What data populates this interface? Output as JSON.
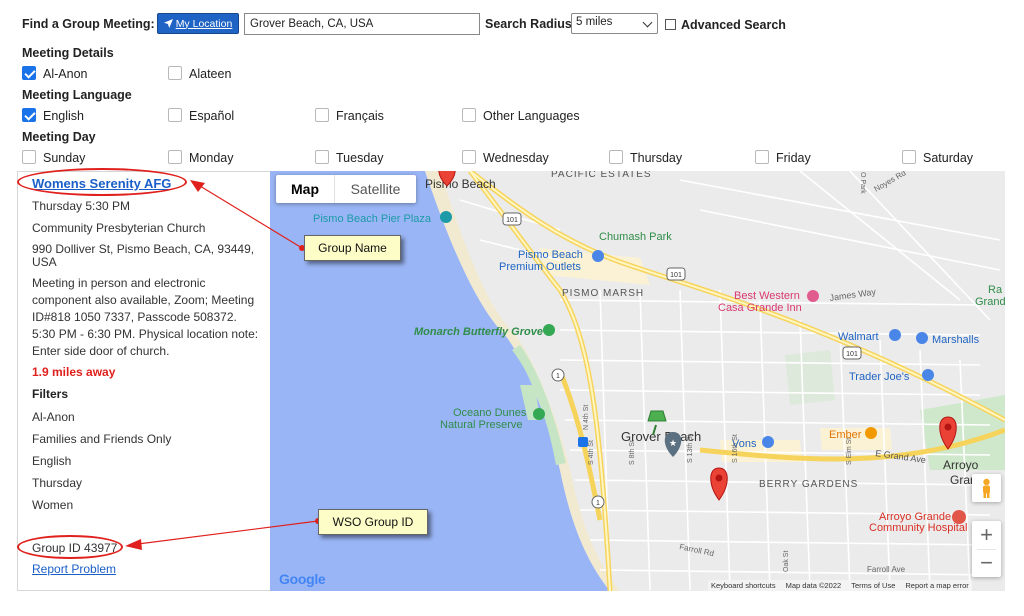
{
  "search": {
    "find_label": "Find a Group Meeting:",
    "my_location_label": "My Location",
    "location_value": "Grover Beach, CA, USA",
    "radius_label": "Search Radius",
    "radius_value": "5 miles",
    "advanced_label": "Advanced Search",
    "advanced_checked": false
  },
  "meeting_details": {
    "heading": "Meeting Details",
    "options": [
      {
        "label": "Al-Anon",
        "checked": true
      },
      {
        "label": "Alateen",
        "checked": false
      }
    ]
  },
  "meeting_language": {
    "heading": "Meeting Language",
    "options": [
      {
        "label": "English",
        "checked": true
      },
      {
        "label": "Español",
        "checked": false
      },
      {
        "label": "Français",
        "checked": false
      },
      {
        "label": "Other Languages",
        "checked": false
      }
    ]
  },
  "meeting_day": {
    "heading": "Meeting Day",
    "options": [
      {
        "label": "Sunday",
        "checked": false
      },
      {
        "label": "Monday",
        "checked": false
      },
      {
        "label": "Tuesday",
        "checked": false
      },
      {
        "label": "Wednesday",
        "checked": false
      },
      {
        "label": "Thursday",
        "checked": false
      },
      {
        "label": "Friday",
        "checked": false
      },
      {
        "label": "Saturday",
        "checked": false
      }
    ]
  },
  "result": {
    "group_name": "Womens Serenity AFG",
    "time": "Thursday 5:30 PM",
    "location_name": "Community Presbyterian Church",
    "address_line1": "990 Dolliver St, Pismo Beach, CA, 93449,",
    "address_line2": "USA",
    "notes": [
      "Meeting in person and electronic",
      "component also available, Zoom; Meeting",
      "ID#818 1050 7337, Passcode 508372.",
      "5:30 PM - 6:30 PM. Physical location note:",
      "Enter side door of church."
    ],
    "distance": "1.9 miles away",
    "filters_heading": "Filters",
    "filters": [
      "Al-Anon",
      "Families and Friends Only",
      "English",
      "Thursday",
      "Women"
    ],
    "group_id": "Group ID 43977",
    "report_label": "Report Problem"
  },
  "annotations": {
    "group_name_callout": "Group Name",
    "group_id_callout": "WSO Group ID"
  },
  "map": {
    "tab_map": "Map",
    "tab_satellite": "Satellite",
    "google_logo": "Google",
    "zoom_in": "+",
    "zoom_out": "−",
    "attribution": [
      "Keyboard shortcuts",
      "Map data ©2022",
      "Terms of Use",
      "Report a map error"
    ],
    "labels": {
      "pismo_beach": "Pismo Beach",
      "pacific_estates": "PACIFIC ESTATES",
      "pier_plaza": "Pismo Beach Pier Plaza",
      "chumash": "Chumash Park",
      "outlets1": "Pismo Beach",
      "outlets2": "Premium Outlets",
      "pismo_marsh": "PISMO MARSH",
      "best_western1": "Best Western",
      "best_western2": "Casa Grande Inn",
      "james_way": "James Way",
      "ra1": "Ra",
      "ra2": "Grand",
      "walmart": "Walmart",
      "marshalls": "Marshalls",
      "trader_joes": "Trader Joe's",
      "monarch": "Monarch Butterfly Grove",
      "oceano1": "Oceano Dunes",
      "oceano2": "Natural Preserve",
      "grover_beach": "Grover Beach",
      "vons": "Vons",
      "ember": "Ember",
      "grand_ave": "E Grand Ave",
      "arroyo1": "Arroyo",
      "arroyo2": "Grand",
      "berry": "BERRY GARDENS",
      "ag_hosp1": "Arroyo Grande",
      "ag_hosp2": "Community Hospital",
      "farroll_rd": "Farroll Rd",
      "farroll_ave": "Farroll Ave",
      "noyes": "Noyes Rd",
      "n4th": "N 4th St",
      "s4th": "S 4th St",
      "s8th": "S 8th St",
      "s13th": "S 13th St",
      "s16th": "S 16th St",
      "selm": "S Elm St",
      "oak": "Oak St",
      "o_park": "O Park",
      "r101a": "101",
      "r101b": "101",
      "r101c": "101",
      "r1a": "1",
      "r1b": "1"
    }
  },
  "colors": {
    "link": "#1a5fc8",
    "accent": "#1a73e8",
    "distance": "#e0201c",
    "annotation": "#e0201c",
    "callout_bg": "#fdfdc8"
  }
}
